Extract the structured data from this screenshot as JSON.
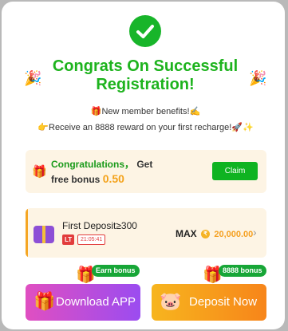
{
  "modal": {
    "title": "Congrats On Successful Registration!",
    "benefit_line1": "New member benefits!",
    "benefit_line2": "Receive an 8888 reward on your first recharge!",
    "icons": {
      "success": "check-circle-icon",
      "party_left": "party-popper-icon",
      "party_right": "party-popper-icon",
      "benefit_gift": "gift-icon",
      "benefit_tail": "pen-icon",
      "recharge_hand": "pointing-hand-icon",
      "rocket": "rocket-icon",
      "sparkle": "sparkle-icon"
    }
  },
  "bonus_card": {
    "label_green": "Congratulations，",
    "label_rest": "Get free bonus",
    "amount": "0.50",
    "claim_label": "Claim"
  },
  "deposit_card": {
    "title": "First Deposit≥300",
    "lt_badge": "LT",
    "timer": "21:05:41",
    "max_label": "MAX",
    "coin_symbol": "₹",
    "max_amount": "20,000.00"
  },
  "buttons": {
    "download": {
      "label": "Download APP",
      "badge": "Earn bonus"
    },
    "deposit": {
      "label": "Deposit Now",
      "badge": "8888 bonus"
    }
  },
  "colors": {
    "accent_green": "#18b52a",
    "card_bg": "#fdf4e4",
    "amount_orange": "#f4a21a",
    "download_gradient": [
      "#e04fc1",
      "#9b4cf0"
    ],
    "deposit_gradient": [
      "#f7b51e",
      "#f7851a"
    ]
  }
}
